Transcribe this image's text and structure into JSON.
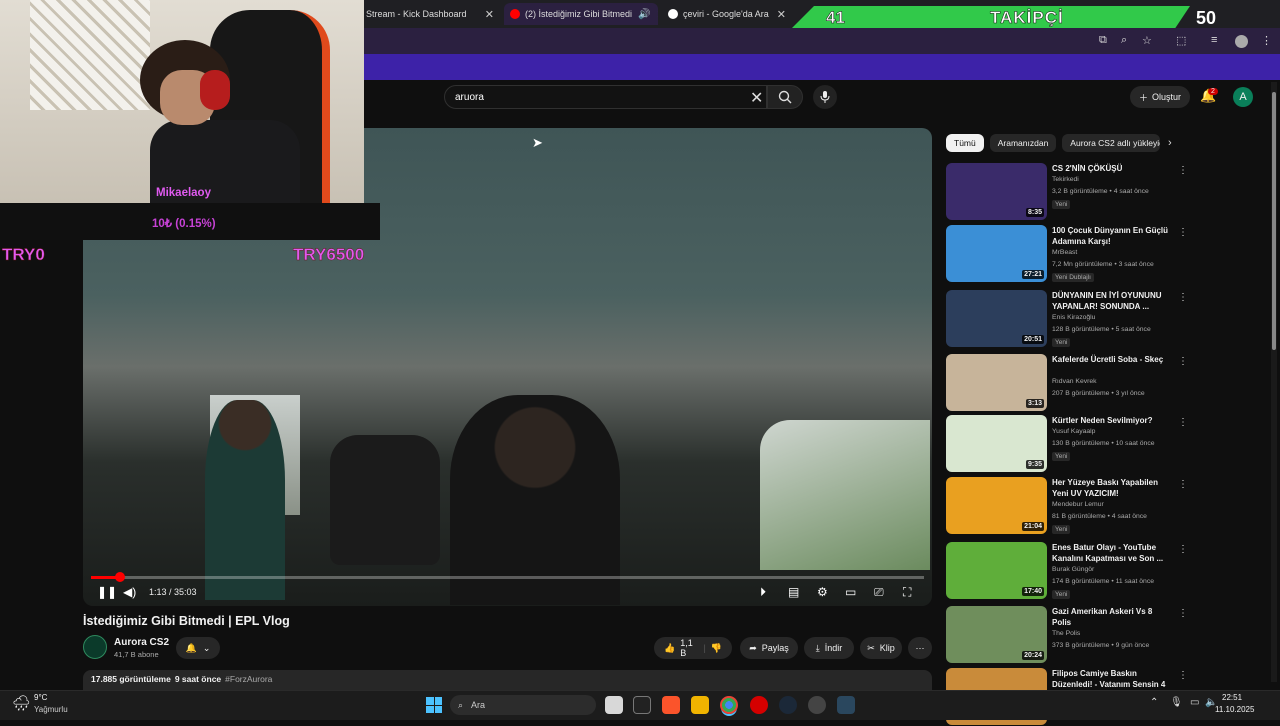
{
  "browser": {
    "tabs": [
      {
        "label": "Stream - Kick Dashboard",
        "active": false,
        "favicon_color": "#53fc18"
      },
      {
        "label": "(2) İstediğimiz Gibi Bitmedi",
        "active": true,
        "favicon_color": "#ff0000"
      },
      {
        "label": "çeviri - Google'da Ara",
        "active": false,
        "favicon_color": "#ffffff"
      }
    ],
    "tab_close": "✕"
  },
  "banner": {
    "left": "41",
    "middle": "TAKİPÇİ",
    "right": "50"
  },
  "youtube": {
    "search": {
      "value": "aruora",
      "clear": "✕"
    },
    "create_label": "Oluştur",
    "notifications": "2",
    "avatar_letter": "A"
  },
  "player": {
    "time": "1:13 / 35:03",
    "progress": 0.035
  },
  "video": {
    "title": "İstediğimiz Gibi Bitmedi | EPL Vlog",
    "channel": "Aurora CS2",
    "subscribers": "41,7 B abone",
    "likes": "1,1 B",
    "share": "Paylaş",
    "download": "İndir",
    "clip": "Klip",
    "more": "⋯",
    "views": "17.885 görüntüleme",
    "age": "9 saat önce",
    "hashtag": "#ForzAurora"
  },
  "sidebar": {
    "chips": [
      "Tümü",
      "Aramanızdan",
      "Aurora CS2 adlı yükleyic"
    ],
    "items": [
      {
        "title": "CS 2'NİN ÇÖKÜŞÜ",
        "channel": "Tekirkedi",
        "meta": "3,2 B görüntüleme • 4 saat önce",
        "badge": "Yeni",
        "duration": "8:35",
        "thumb": "#3a2b6a"
      },
      {
        "title": "100 Çocuk Dünyanın En Güçlü Adamına Karşı!",
        "channel": "MrBeast",
        "meta": "7,2 Mn görüntüleme • 3 saat önce",
        "badge": "Yeni  Dublajlı",
        "duration": "27:21",
        "thumb": "#3b8fd6"
      },
      {
        "title": "DÜNYANIN EN İYİ OYUNUNU YAPANLAR! SONUNDA ...",
        "channel": "Enis Kirazoğlu",
        "meta": "128 B görüntüleme • 5 saat önce",
        "badge": "Yeni",
        "duration": "20:51",
        "thumb": "#2c3e5c"
      },
      {
        "title": "Kafelerde Ücretli Soba - Skeç",
        "channel": "Rıdvan Kevrek",
        "meta": "207 B görüntüleme • 3 yıl önce",
        "badge": "",
        "duration": "3:13",
        "thumb": "#c7b49a"
      },
      {
        "title": "Kürtler Neden Sevilmiyor?",
        "channel": "Yusuf Kayaalp",
        "meta": "130 B görüntüleme • 10 saat önce",
        "badge": "Yeni",
        "duration": "9:35",
        "thumb": "#d9e7d0"
      },
      {
        "title": "Her Yüzeye Baskı Yapabilen Yeni UV YAZICIM!",
        "channel": "Mendebur Lemur",
        "meta": "81 B görüntüleme • 4 saat önce",
        "badge": "Yeni",
        "duration": "21:04",
        "thumb": "#e9a020"
      },
      {
        "title": "Enes Batur Olayı - YouTube Kanalını Kapatması ve Son ...",
        "channel": "Burak Güngör",
        "meta": "174 B görüntüleme • 11 saat önce",
        "badge": "Yeni",
        "duration": "17:40",
        "thumb": "#5fae3a"
      },
      {
        "title": "Gazi Amerikan Askeri Vs 8 Polis",
        "channel": "The Polis",
        "meta": "373 B görüntüleme • 9 gün önce",
        "badge": "",
        "duration": "20:24",
        "thumb": "#6f8e5c"
      },
      {
        "title": "Filipos Camiye Baskın Düzenledi! - Vatanım Sensin 4",
        "channel": "",
        "meta": "",
        "badge": "",
        "duration": "",
        "thumb": "#c98b3a"
      }
    ]
  },
  "stream_overlay": {
    "donor": "Mikaelaoy",
    "donation": "10₺ (0.15%)",
    "goal_left": "TRY0",
    "goal_right": "TRY6500"
  },
  "taskbar": {
    "temperature": "9°C",
    "weather": "Yağmurlu",
    "search": "Ara",
    "time": "22:51",
    "date": "11.10.2025"
  }
}
